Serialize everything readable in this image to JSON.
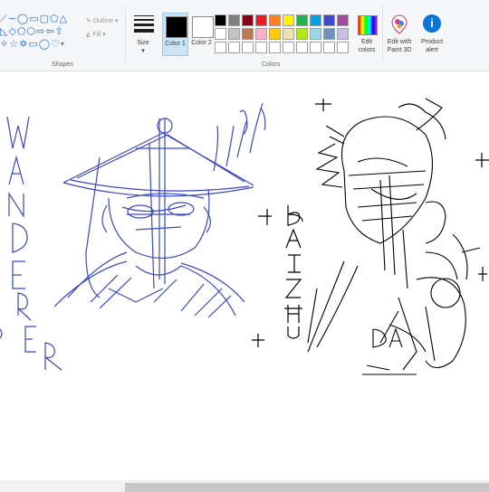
{
  "ribbon": {
    "shapes_label": "Shapes",
    "outline_label": "Outline",
    "fill_label": "Fill",
    "size_label": "Size",
    "color1_label": "Color 1",
    "color2_label": "Color 2",
    "colors_label": "Colors",
    "edit_colors_label": "Edit colors",
    "paint3d_label": "Edit with Paint 3D",
    "product_alert_label": "Product alert"
  },
  "colors": {
    "color1": "#000000",
    "color2": "#ffffff",
    "palette_row1": [
      "#000000",
      "#7f7f7f",
      "#880015",
      "#ed1c24",
      "#ff7f27",
      "#fff200",
      "#22b14c",
      "#00a2e8",
      "#3f48cc",
      "#a349a4"
    ],
    "palette_row2": [
      "#ffffff",
      "#c3c3c3",
      "#b97a57",
      "#ffaec9",
      "#ffc90e",
      "#efe4b0",
      "#b5e61d",
      "#99d9ea",
      "#7092be",
      "#c8bfe7"
    ],
    "palette_row3": [
      "#ffffff",
      "#ffffff",
      "#ffffff",
      "#ffffff",
      "#ffffff",
      "#ffffff",
      "#ffffff",
      "#ffffff",
      "#ffffff",
      "#ffffff"
    ]
  },
  "canvas": {
    "left_drawing_letters": [
      "W",
      "A",
      "N",
      "D",
      "E",
      "R",
      "E",
      "R"
    ],
    "right_drawing_letters": [
      "B",
      "A",
      "I",
      "Z",
      "H",
      "U"
    ],
    "right_bottom_text": "DA"
  }
}
